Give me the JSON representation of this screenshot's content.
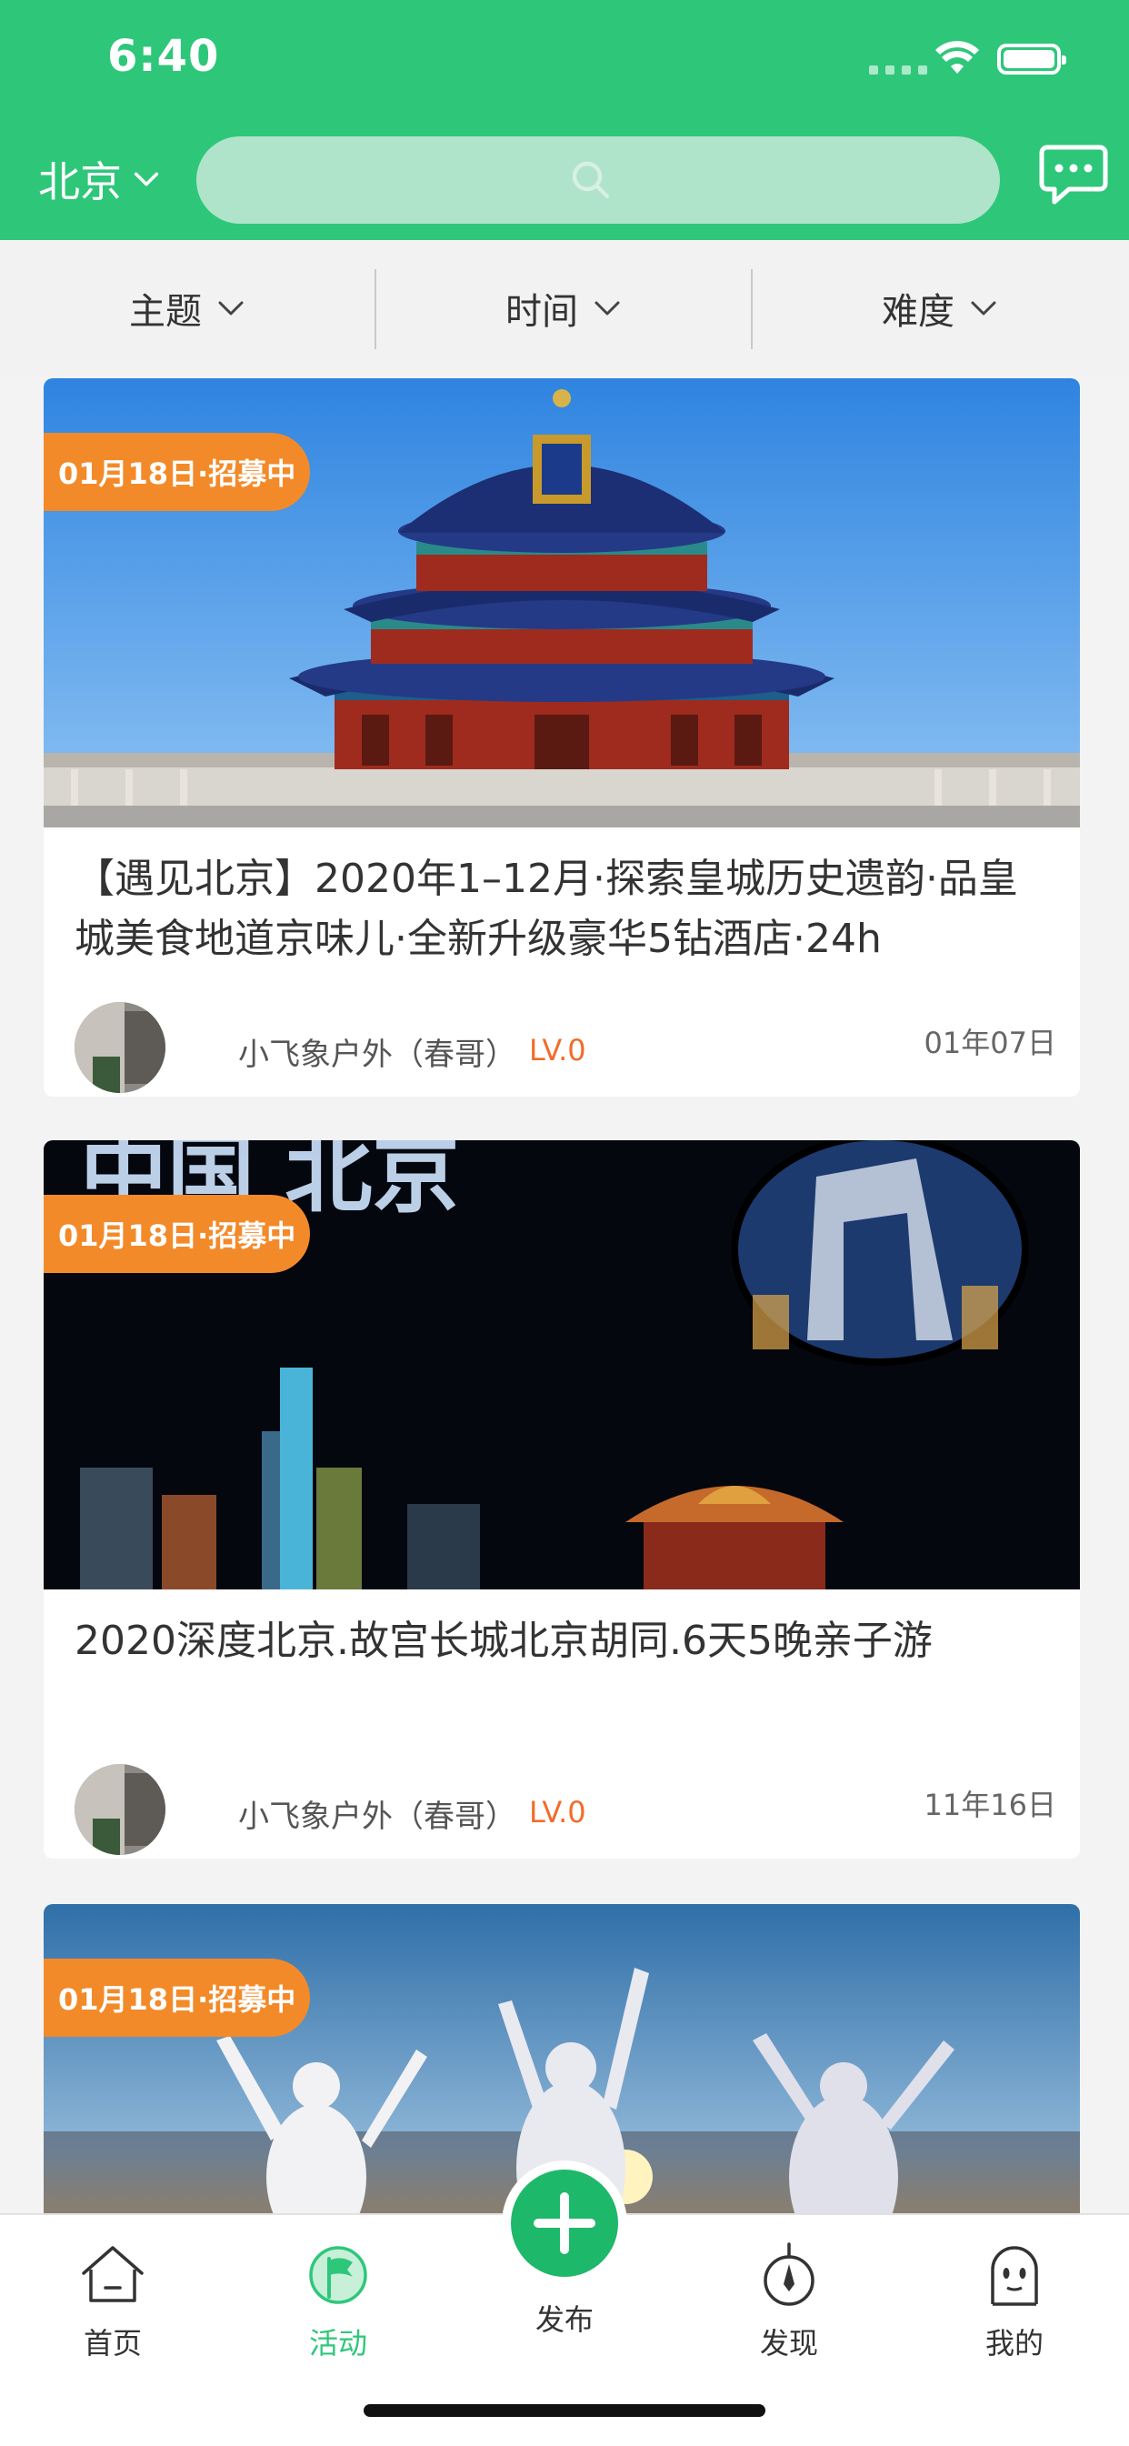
{
  "status": {
    "time": "6:40"
  },
  "header": {
    "city": "北京"
  },
  "filters": [
    "主题",
    "时间",
    "难度"
  ],
  "cards": [
    {
      "tag": "01月18日·招募中",
      "title": "【遇见北京】2020年1–12月·探索皇城历史遗韵·品皇城美食地道京味儿·全新升级豪华5钻酒店·24h",
      "author": "小飞象户外（春哥）",
      "level": "LV.0",
      "date": "01年07日",
      "photo": "temple-of-heaven"
    },
    {
      "tag": "01月18日·招募中",
      "title": "2020深度北京.故宫长城北京胡同.6天5晚亲子游",
      "author": "小飞象户外（春哥）",
      "level": "LV.0",
      "date": "11年16日",
      "photo": "beijing-night"
    },
    {
      "tag": "01月18日·招募中",
      "photo": "sunset-celebration"
    }
  ],
  "tabbar": {
    "items": [
      "首页",
      "活动",
      "发布",
      "发现",
      "我的"
    ],
    "active": "活动"
  },
  "colors": {
    "brand": "#2ec77a",
    "tag": "#f38a2a",
    "level": "#f26c2a"
  }
}
